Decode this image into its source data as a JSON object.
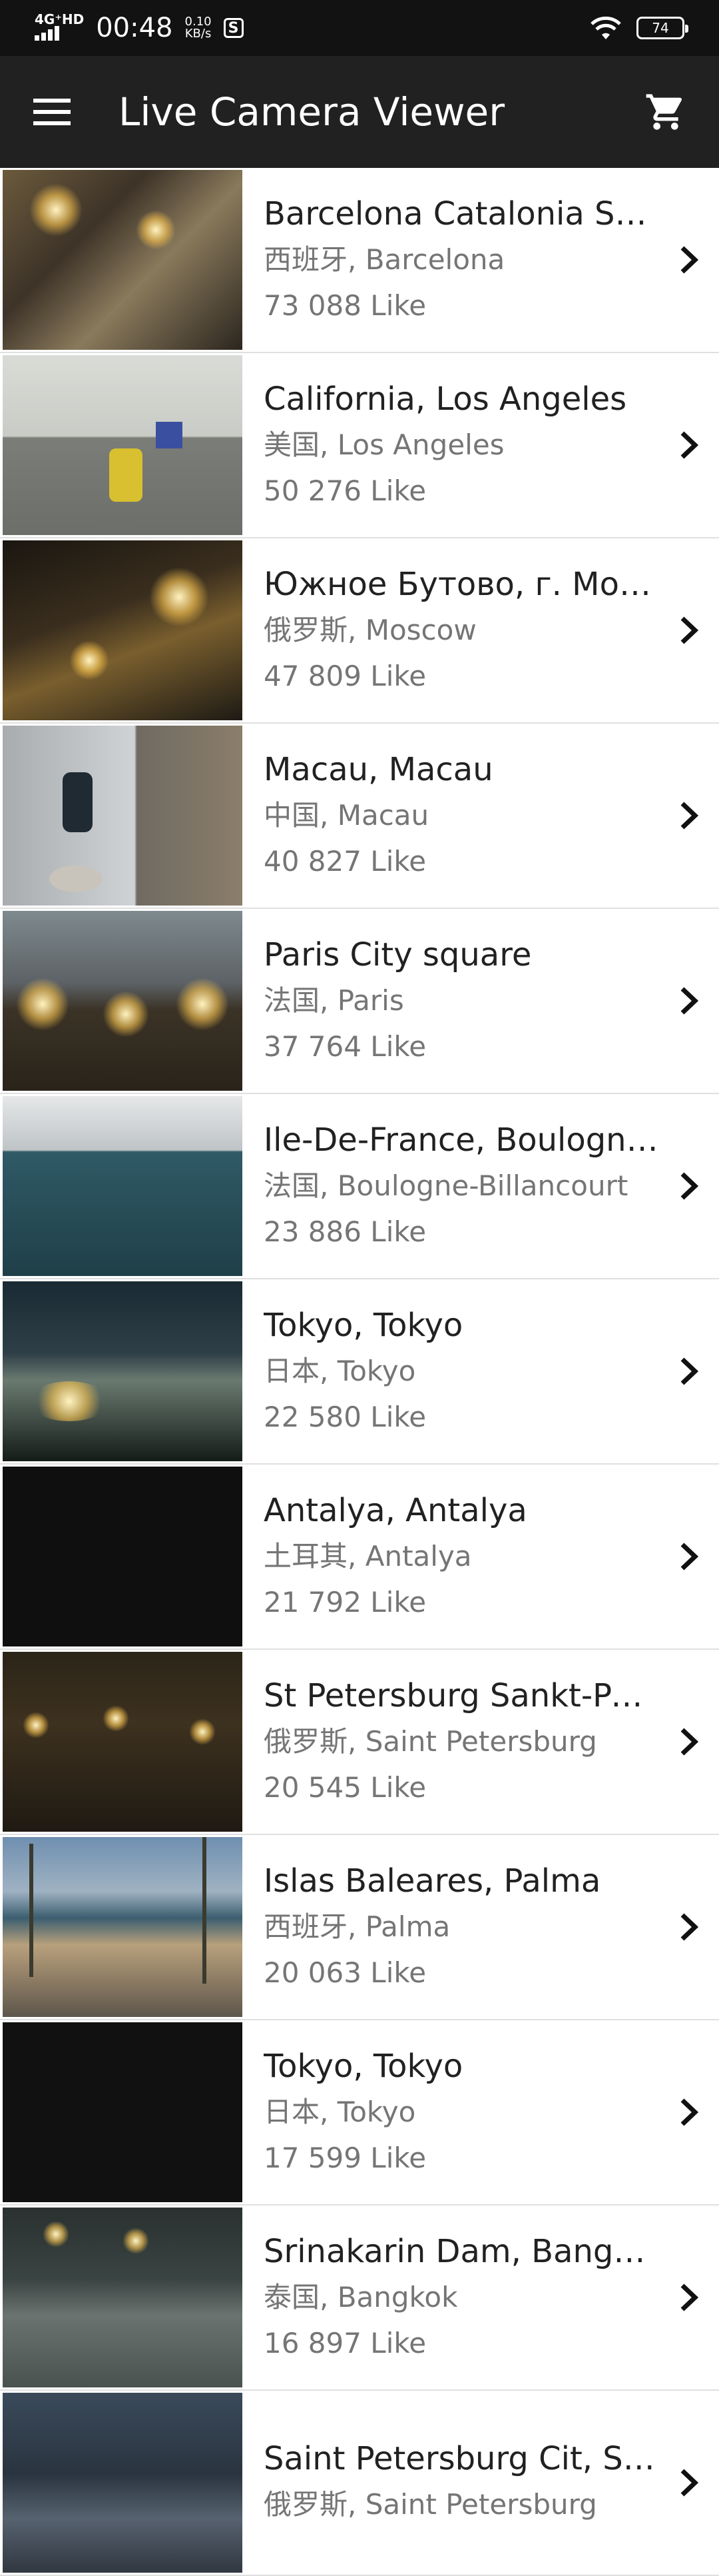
{
  "status_bar": {
    "network": "4G⁺HD",
    "time": "00:48",
    "speed_value": "0.10",
    "speed_unit": "KB/s",
    "app_badge": "S",
    "battery": "74"
  },
  "app_bar": {
    "title": "Live Camera Viewer",
    "menu_icon": "menu-icon",
    "cart_icon": "cart-icon"
  },
  "cameras": [
    {
      "name": "Barcelona Catalonia Sp…",
      "country": "西班牙",
      "city": "Barcelona",
      "likes": "73 088 Like"
    },
    {
      "name": "California, Los Angeles",
      "country": "美国",
      "city": "Los Angeles",
      "likes": "50 276 Like"
    },
    {
      "name": "Южное Бутово, г. Мос…",
      "country": "俄罗斯",
      "city": "Moscow",
      "likes": "47 809 Like"
    },
    {
      "name": "Macau, Macau",
      "country": "中国",
      "city": "Macau",
      "likes": "40 827 Like"
    },
    {
      "name": "Paris City square",
      "country": "法国",
      "city": "Paris",
      "likes": "37 764 Like"
    },
    {
      "name": "Ile-De-France, Boulogn…",
      "country": "法国",
      "city": "Boulogne-Billancourt",
      "likes": "23 886 Like"
    },
    {
      "name": "Tokyo, Tokyo",
      "country": "日本",
      "city": "Tokyo",
      "likes": "22 580 Like"
    },
    {
      "name": "Antalya, Antalya",
      "country": "土耳其",
      "city": "Antalya",
      "likes": "21 792 Like"
    },
    {
      "name": "St Petersburg Sankt-Pe…",
      "country": "俄罗斯",
      "city": "Saint Petersburg",
      "likes": "20 545 Like"
    },
    {
      "name": "Islas Baleares, Palma",
      "country": "西班牙",
      "city": "Palma",
      "likes": "20 063 Like"
    },
    {
      "name": "Tokyo, Tokyo",
      "country": "日本",
      "city": "Tokyo",
      "likes": "17 599 Like"
    },
    {
      "name": "Srinakarin Dam, Bangk…",
      "country": "泰国",
      "city": "Bangkok",
      "likes": "16 897 Like"
    },
    {
      "name": "Saint Petersburg Cit, S…",
      "country": "俄罗斯",
      "city": "Saint Petersburg",
      "likes": ""
    }
  ]
}
